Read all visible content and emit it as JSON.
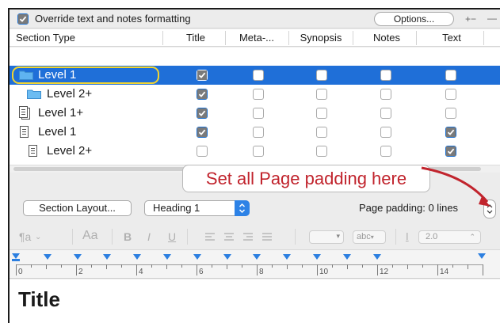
{
  "override": {
    "checked": true,
    "label": "Override text and notes formatting"
  },
  "options_button": "Options...",
  "window_controls": {
    "add_remove": "+−",
    "menu": "—"
  },
  "table": {
    "columns": [
      "Section Type",
      "Title",
      "Meta-...",
      "Synopsis",
      "Notes",
      "Text"
    ],
    "rows": [
      {
        "icon": "folder-icon",
        "label": "Level  1",
        "selected": true,
        "checks": [
          true,
          false,
          false,
          false,
          false
        ]
      },
      {
        "icon": "folder-icon",
        "label": "Level  2+",
        "selected": false,
        "checks": [
          true,
          false,
          false,
          false,
          false
        ]
      },
      {
        "icon": "document-stack-icon",
        "label": "Level  1+",
        "selected": false,
        "checks": [
          true,
          false,
          false,
          false,
          false
        ]
      },
      {
        "icon": "document-icon",
        "label": "Level  1",
        "selected": false,
        "checks": [
          true,
          false,
          false,
          false,
          true
        ]
      },
      {
        "icon": "document-icon",
        "label": "Level  2+",
        "selected": false,
        "checks": [
          false,
          false,
          false,
          false,
          true
        ]
      }
    ]
  },
  "annotation": "Set all Page padding here",
  "layout_bar": {
    "section_layout_button": "Section Layout...",
    "style_select": "Heading 1",
    "page_padding_label": "Page padding: 0 lines"
  },
  "format_bar": {
    "paragraph_glyph": "¶a",
    "font_glyph": "Aa",
    "bold": "B",
    "italic": "I",
    "underline": "U",
    "abc": "abc",
    "line_spacing": "2.0"
  },
  "ruler": {
    "labels": [
      "0",
      "2",
      "4",
      "6",
      "8",
      "10",
      "12",
      "14"
    ]
  },
  "editor": {
    "text": "Title"
  },
  "colors": {
    "selection": "#1f6fd8",
    "checkbox": "#2f8ff0",
    "annotation": "#c1242d",
    "highlight": "#f2d430"
  }
}
